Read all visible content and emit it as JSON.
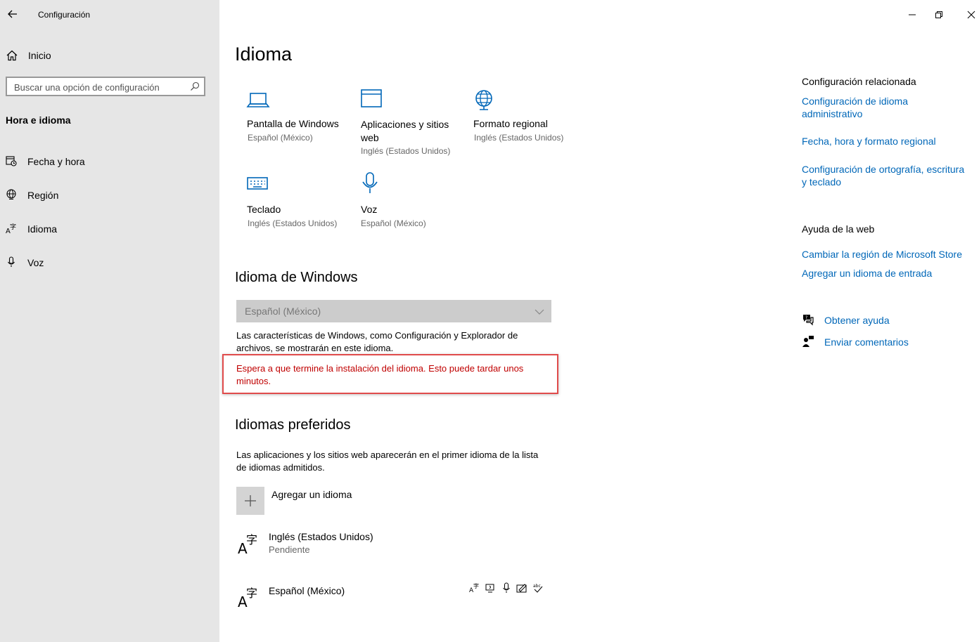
{
  "window": {
    "title": "Configuración"
  },
  "sidebar": {
    "home_label": "Inicio",
    "search_placeholder": "Buscar una opción de configuración",
    "section_title": "Hora e idioma",
    "items": [
      {
        "label": "Fecha y hora",
        "icon": "calendar-clock-icon"
      },
      {
        "label": "Región",
        "icon": "globe-icon"
      },
      {
        "label": "Idioma",
        "icon": "language-icon"
      },
      {
        "label": "Voz",
        "icon": "microphone-icon"
      }
    ]
  },
  "main": {
    "title": "Idioma",
    "tiles": [
      {
        "title": "Pantalla de Windows",
        "sub": "Español (México)",
        "icon": "laptop-icon"
      },
      {
        "title": "Aplicaciones y sitios web",
        "sub": "Inglés (Estados Unidos)",
        "icon": "window-icon"
      },
      {
        "title": "Formato regional",
        "sub": "Inglés (Estados Unidos)",
        "icon": "globe-format-icon"
      },
      {
        "title": "Teclado",
        "sub": "Inglés (Estados Unidos)",
        "icon": "keyboard-icon"
      },
      {
        "title": "Voz",
        "sub": "Español (México)",
        "icon": "microphone-icon"
      }
    ],
    "windows_language": {
      "heading": "Idioma de Windows",
      "dropdown_value": "Español (México)",
      "description": "Las características de Windows, como Configuración y Explorador de archivos, se mostrarán en este idioma.",
      "warning": "Espera a que termine la instalación del idioma. Esto puede tardar unos minutos."
    },
    "preferred": {
      "heading": "Idiomas preferidos",
      "description": "Las aplicaciones y los sitios web aparecerán en el primer idioma de la lista de idiomas admitidos.",
      "add_label": "Agregar un idioma",
      "languages": [
        {
          "name": "Inglés (Estados Unidos)",
          "status": "Pendiente"
        },
        {
          "name": "Español (México)",
          "status": ""
        }
      ]
    }
  },
  "related": {
    "heading": "Configuración relacionada",
    "links": [
      "Configuración de idioma administrativo",
      "Fecha, hora y formato regional",
      "Configuración de ortografía, escritura y teclado"
    ]
  },
  "web_help": {
    "heading": "Ayuda de la web",
    "links": [
      "Cambiar la región de Microsoft Store",
      "Agregar un idioma de entrada"
    ]
  },
  "support": {
    "get_help": "Obtener ayuda",
    "feedback": "Enviar comentarios"
  },
  "colors": {
    "accent": "#0067b8",
    "warning": "#c00000",
    "highlight_border": "#e04b4b",
    "sidebar_bg": "#e6e6e6"
  }
}
